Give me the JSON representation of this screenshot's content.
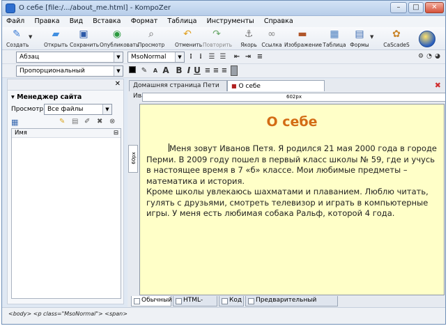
{
  "window": {
    "title": "О себе [file:/.../about_me.html] - KompoZer"
  },
  "menu": [
    "Файл",
    "Правка",
    "Вид",
    "Вставка",
    "Формат",
    "Таблица",
    "Инструменты",
    "Справка"
  ],
  "toolbar": [
    {
      "label": "Создать",
      "icon": "new-document-icon",
      "glyph": "✎"
    },
    {
      "label": "Открыть",
      "icon": "open-folder-icon",
      "glyph": "📂"
    },
    {
      "label": "Сохранить",
      "icon": "save-icon",
      "glyph": "💾"
    },
    {
      "label": "Опубликовать",
      "icon": "publish-globe-icon",
      "glyph": "🌐"
    },
    {
      "label": "Просмотр",
      "icon": "preview-magnifier-icon",
      "glyph": "🔍"
    },
    {
      "label": "Отменить",
      "icon": "undo-icon",
      "glyph": "↶"
    },
    {
      "label": "Повторить",
      "icon": "redo-icon",
      "glyph": "↷"
    },
    {
      "label": "Якорь",
      "icon": "anchor-icon",
      "glyph": "⚓"
    },
    {
      "label": "Ссылка",
      "icon": "link-icon",
      "glyph": "🔗"
    },
    {
      "label": "Изображение",
      "icon": "image-icon",
      "glyph": "▬"
    },
    {
      "label": "Таблица",
      "icon": "table-icon",
      "glyph": "▦"
    },
    {
      "label": "Формы",
      "icon": "forms-icon",
      "glyph": "▤"
    },
    {
      "label": "CaScadeS",
      "icon": "cascades-palette-icon",
      "glyph": "🎨"
    }
  ],
  "format": {
    "paragraph": "Абзац",
    "class": "MsoNormal",
    "font": "Пропорциональный",
    "bold": "B",
    "italic": "I",
    "underline": "U",
    "larger": "A",
    "smaller": "A"
  },
  "sidebar": {
    "title": "Менеджер сайта",
    "view_label": "Просмотр",
    "view_value": "Все файлы",
    "column_name": "Имя"
  },
  "tabs": [
    {
      "label": "Домашняя страница Пети Иван..."
    },
    {
      "label": "О себе"
    }
  ],
  "ruler": {
    "width_label": "602px",
    "height_label": "60px"
  },
  "document": {
    "heading": "О себе",
    "paragraph1": "Меня зовут Иванов Петя. Я родился 21 мая 2000 года в городе Перми. В 2009 году пошел в первый класс школы № 59, где и учусь в настоящее время в 7 «б» классе. Мои любимые предметы – математика и история.",
    "paragraph2": "Кроме школы увлекаюсь шахматами и плаванием. Люблю читать, гулять с друзьями, смотреть телевизор и играть в компьютерные игры. У меня есть любимая собака Ральф, которой 4 года."
  },
  "mode_tabs": [
    "Обычный",
    "HTML-теги",
    "Код",
    "Предварительный просмотр"
  ],
  "status": {
    "path": "<body> <p class=\"MsoNormal\"> <span>"
  },
  "colors": {
    "heading": "#d36c15",
    "page_bg": "#ffffc8",
    "close_tab": "#d03030"
  }
}
